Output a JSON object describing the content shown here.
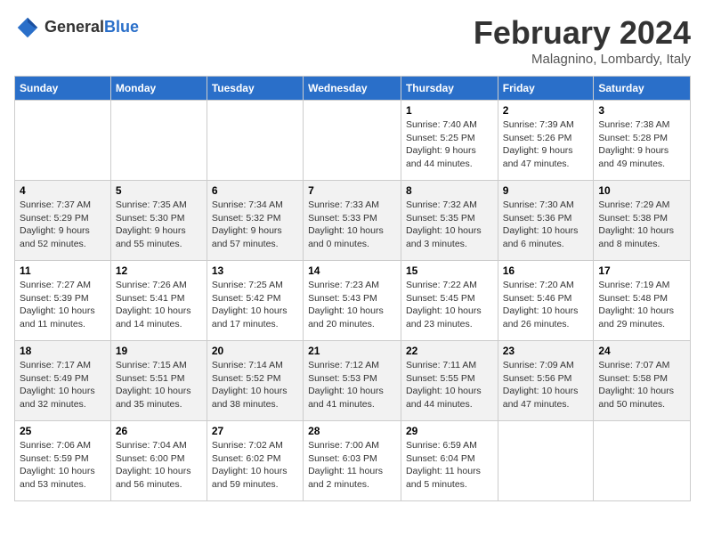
{
  "header": {
    "logo_line1": "General",
    "logo_line2": "Blue",
    "month": "February 2024",
    "location": "Malagnino, Lombardy, Italy"
  },
  "days_of_week": [
    "Sunday",
    "Monday",
    "Tuesday",
    "Wednesday",
    "Thursday",
    "Friday",
    "Saturday"
  ],
  "weeks": [
    [
      {
        "day": "",
        "info": ""
      },
      {
        "day": "",
        "info": ""
      },
      {
        "day": "",
        "info": ""
      },
      {
        "day": "",
        "info": ""
      },
      {
        "day": "1",
        "info": "Sunrise: 7:40 AM\nSunset: 5:25 PM\nDaylight: 9 hours\nand 44 minutes."
      },
      {
        "day": "2",
        "info": "Sunrise: 7:39 AM\nSunset: 5:26 PM\nDaylight: 9 hours\nand 47 minutes."
      },
      {
        "day": "3",
        "info": "Sunrise: 7:38 AM\nSunset: 5:28 PM\nDaylight: 9 hours\nand 49 minutes."
      }
    ],
    [
      {
        "day": "4",
        "info": "Sunrise: 7:37 AM\nSunset: 5:29 PM\nDaylight: 9 hours\nand 52 minutes."
      },
      {
        "day": "5",
        "info": "Sunrise: 7:35 AM\nSunset: 5:30 PM\nDaylight: 9 hours\nand 55 minutes."
      },
      {
        "day": "6",
        "info": "Sunrise: 7:34 AM\nSunset: 5:32 PM\nDaylight: 9 hours\nand 57 minutes."
      },
      {
        "day": "7",
        "info": "Sunrise: 7:33 AM\nSunset: 5:33 PM\nDaylight: 10 hours\nand 0 minutes."
      },
      {
        "day": "8",
        "info": "Sunrise: 7:32 AM\nSunset: 5:35 PM\nDaylight: 10 hours\nand 3 minutes."
      },
      {
        "day": "9",
        "info": "Sunrise: 7:30 AM\nSunset: 5:36 PM\nDaylight: 10 hours\nand 6 minutes."
      },
      {
        "day": "10",
        "info": "Sunrise: 7:29 AM\nSunset: 5:38 PM\nDaylight: 10 hours\nand 8 minutes."
      }
    ],
    [
      {
        "day": "11",
        "info": "Sunrise: 7:27 AM\nSunset: 5:39 PM\nDaylight: 10 hours\nand 11 minutes."
      },
      {
        "day": "12",
        "info": "Sunrise: 7:26 AM\nSunset: 5:41 PM\nDaylight: 10 hours\nand 14 minutes."
      },
      {
        "day": "13",
        "info": "Sunrise: 7:25 AM\nSunset: 5:42 PM\nDaylight: 10 hours\nand 17 minutes."
      },
      {
        "day": "14",
        "info": "Sunrise: 7:23 AM\nSunset: 5:43 PM\nDaylight: 10 hours\nand 20 minutes."
      },
      {
        "day": "15",
        "info": "Sunrise: 7:22 AM\nSunset: 5:45 PM\nDaylight: 10 hours\nand 23 minutes."
      },
      {
        "day": "16",
        "info": "Sunrise: 7:20 AM\nSunset: 5:46 PM\nDaylight: 10 hours\nand 26 minutes."
      },
      {
        "day": "17",
        "info": "Sunrise: 7:19 AM\nSunset: 5:48 PM\nDaylight: 10 hours\nand 29 minutes."
      }
    ],
    [
      {
        "day": "18",
        "info": "Sunrise: 7:17 AM\nSunset: 5:49 PM\nDaylight: 10 hours\nand 32 minutes."
      },
      {
        "day": "19",
        "info": "Sunrise: 7:15 AM\nSunset: 5:51 PM\nDaylight: 10 hours\nand 35 minutes."
      },
      {
        "day": "20",
        "info": "Sunrise: 7:14 AM\nSunset: 5:52 PM\nDaylight: 10 hours\nand 38 minutes."
      },
      {
        "day": "21",
        "info": "Sunrise: 7:12 AM\nSunset: 5:53 PM\nDaylight: 10 hours\nand 41 minutes."
      },
      {
        "day": "22",
        "info": "Sunrise: 7:11 AM\nSunset: 5:55 PM\nDaylight: 10 hours\nand 44 minutes."
      },
      {
        "day": "23",
        "info": "Sunrise: 7:09 AM\nSunset: 5:56 PM\nDaylight: 10 hours\nand 47 minutes."
      },
      {
        "day": "24",
        "info": "Sunrise: 7:07 AM\nSunset: 5:58 PM\nDaylight: 10 hours\nand 50 minutes."
      }
    ],
    [
      {
        "day": "25",
        "info": "Sunrise: 7:06 AM\nSunset: 5:59 PM\nDaylight: 10 hours\nand 53 minutes."
      },
      {
        "day": "26",
        "info": "Sunrise: 7:04 AM\nSunset: 6:00 PM\nDaylight: 10 hours\nand 56 minutes."
      },
      {
        "day": "27",
        "info": "Sunrise: 7:02 AM\nSunset: 6:02 PM\nDaylight: 10 hours\nand 59 minutes."
      },
      {
        "day": "28",
        "info": "Sunrise: 7:00 AM\nSunset: 6:03 PM\nDaylight: 11 hours\nand 2 minutes."
      },
      {
        "day": "29",
        "info": "Sunrise: 6:59 AM\nSunset: 6:04 PM\nDaylight: 11 hours\nand 5 minutes."
      },
      {
        "day": "",
        "info": ""
      },
      {
        "day": "",
        "info": ""
      }
    ]
  ]
}
